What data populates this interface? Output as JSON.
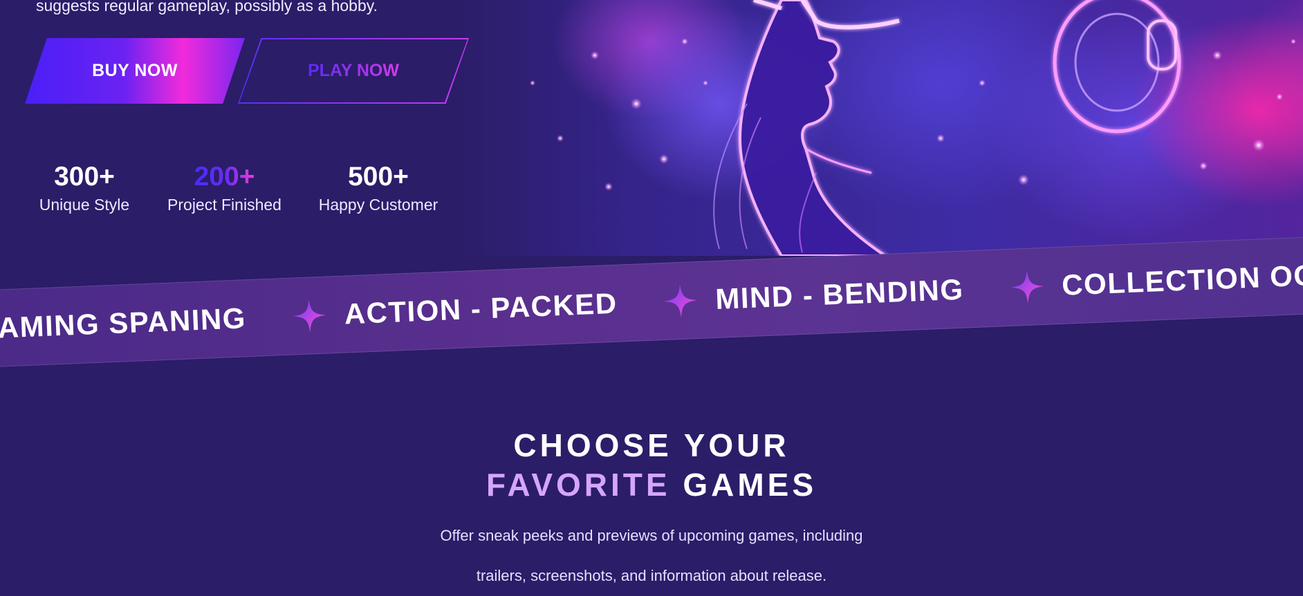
{
  "hero": {
    "description": "suggests regular gameplay, possibly as a hobby.",
    "buy_label": "BUY NOW",
    "play_label": "PLAY NOW",
    "art_description_icon": "vr-gamer-art"
  },
  "stats": [
    {
      "value": "300+",
      "label": "Unique Style"
    },
    {
      "value": "200+",
      "label": "Project Finished"
    },
    {
      "value": "500+",
      "label": "Happy Customer"
    }
  ],
  "ribbon": {
    "items": [
      "AMING SPANING",
      "ACTION - PACKED",
      "MIND - BENDING",
      "COLLECTION OG G"
    ],
    "separator_icon": "sparkle-icon"
  },
  "section": {
    "title_line1": "CHOOSE YOUR",
    "title_accent": "FAVORITE",
    "title_line2_rest": "GAMES",
    "desc_line1": "Offer sneak peeks and previews of upcoming games, including",
    "desc_line2": "trailers, screenshots, and information about release."
  },
  "colors": {
    "background": "#2b1d68",
    "accent_purple": "#d5a6fb",
    "gradient_blue": "#4a1ff7",
    "gradient_pink": "#f12bdc"
  }
}
